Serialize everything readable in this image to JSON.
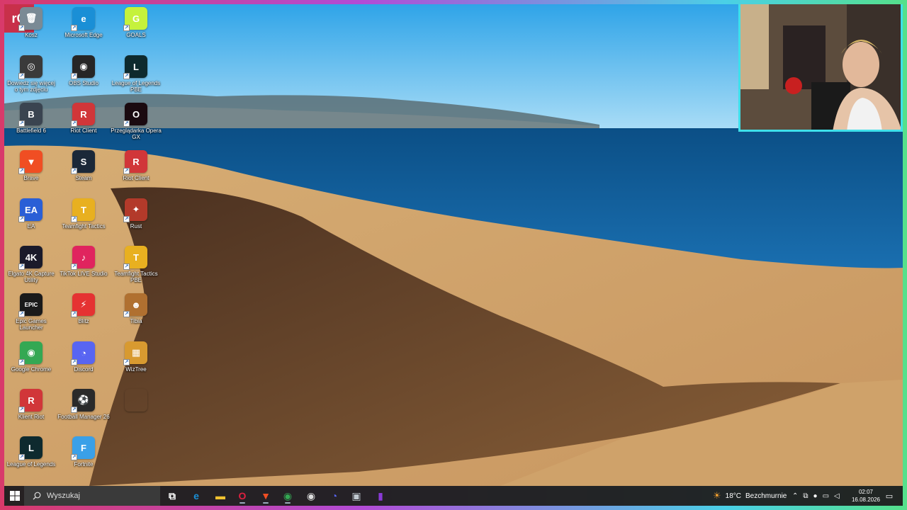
{
  "brand": {
    "logo_text": "rO",
    "logo_color": "#c8304a",
    "frame_colors": [
      "#d83a6a",
      "#b24bd6",
      "#4ad0e6",
      "#55e08a"
    ]
  },
  "desktop": {
    "icons": [
      {
        "label": "Kosz",
        "icon": "recycle-bin-icon",
        "color": "#7a8a95",
        "glyph": "🗑"
      },
      {
        "label": "Microsoft Edge",
        "icon": "edge-icon",
        "color": "#1a8fd6",
        "glyph": "e"
      },
      {
        "label": "GOALS",
        "icon": "goals-icon",
        "color": "#c5f23c",
        "glyph": "G"
      },
      {
        "label": "Dowiedz się więcej o tym zdjęciu",
        "icon": "camera-info-icon",
        "color": "#3a3a3a",
        "glyph": "◎"
      },
      {
        "label": "OBS Studio",
        "icon": "obs-icon",
        "color": "#262626",
        "glyph": "◉"
      },
      {
        "label": "League of Legends PBE",
        "icon": "league-pbe-icon",
        "color": "#0e2a2e",
        "glyph": "L"
      },
      {
        "label": "Battlefield 6",
        "icon": "battlefield-icon",
        "color": "#3a4450",
        "glyph": "B"
      },
      {
        "label": "Riot Client",
        "icon": "riot-client-icon",
        "color": "#d13639",
        "glyph": "R"
      },
      {
        "label": "Przeglądarka Opera GX",
        "icon": "opera-gx-icon",
        "color": "#1a0a10",
        "glyph": "O"
      },
      {
        "label": "Brave",
        "icon": "brave-icon",
        "color": "#f04e23",
        "glyph": "▼"
      },
      {
        "label": "Steam",
        "icon": "steam-icon",
        "color": "#1b2838",
        "glyph": "S"
      },
      {
        "label": "Riot Client",
        "icon": "riot-client-icon",
        "color": "#d13639",
        "glyph": "R"
      },
      {
        "label": "EA",
        "icon": "ea-icon",
        "color": "#2a5fd6",
        "glyph": "EA"
      },
      {
        "label": "Teamfight Tactics",
        "icon": "tft-icon",
        "color": "#e8b020",
        "glyph": "T"
      },
      {
        "label": "Rust",
        "icon": "rust-icon",
        "color": "#b33a2a",
        "glyph": "✦"
      },
      {
        "label": "Elgato 4K Capture Utility",
        "icon": "elgato-icon",
        "color": "#1a1a2a",
        "glyph": "4K"
      },
      {
        "label": "TikTok LIVE Studio",
        "icon": "tiktok-icon",
        "color": "#e0245e",
        "glyph": "♪"
      },
      {
        "label": "Teamfight Tactics PBE",
        "icon": "tft-pbe-icon",
        "color": "#e8b020",
        "glyph": "T"
      },
      {
        "label": "Epic Games Launcher",
        "icon": "epic-icon",
        "color": "#1a1a1a",
        "glyph": "EPIC"
      },
      {
        "label": "Blitz",
        "icon": "blitz-icon",
        "color": "#e53232",
        "glyph": "⚡"
      },
      {
        "label": "Tibia",
        "icon": "tibia-icon",
        "color": "#b07030",
        "glyph": "☻"
      },
      {
        "label": "Google Chrome",
        "icon": "chrome-icon",
        "color": "#34a853",
        "glyph": "◉"
      },
      {
        "label": "Discord",
        "icon": "discord-icon",
        "color": "#5865f2",
        "glyph": "◔"
      },
      {
        "label": "WizTree",
        "icon": "wiztree-icon",
        "color": "#d89a30",
        "glyph": "▦"
      },
      {
        "label": "Klient Riot",
        "icon": "riot-client-icon",
        "color": "#d13639",
        "glyph": "R"
      },
      {
        "label": "Football Manager 26",
        "icon": "football-manager-icon",
        "color": "#2a2a2a",
        "glyph": "⚽"
      },
      {
        "label": "",
        "icon": "blank-icon",
        "color": "transparent",
        "glyph": ""
      },
      {
        "label": "League of Legends",
        "icon": "league-icon",
        "color": "#0e2a2e",
        "glyph": "L"
      },
      {
        "label": "Fortnite",
        "icon": "fortnite-icon",
        "color": "#3aa0e8",
        "glyph": "F"
      }
    ]
  },
  "taskbar": {
    "search_placeholder": "Wyszukaj",
    "apps": [
      {
        "icon": "task-view-icon",
        "color": "#ffffff",
        "glyph": "⧉"
      },
      {
        "icon": "edge-icon",
        "color": "#1a8fd6",
        "glyph": "e"
      },
      {
        "icon": "file-explorer-icon",
        "color": "#f2c230",
        "glyph": "▬"
      },
      {
        "icon": "opera-gx-icon",
        "color": "#e02040",
        "glyph": "O"
      },
      {
        "icon": "brave-icon",
        "color": "#f04e23",
        "glyph": "▼"
      },
      {
        "icon": "chrome-icon",
        "color": "#34a853",
        "glyph": "◉"
      },
      {
        "icon": "obs-icon",
        "color": "#dddddd",
        "glyph": "◉"
      },
      {
        "icon": "discord-icon",
        "color": "#5865f2",
        "glyph": "◔"
      },
      {
        "icon": "app-icon",
        "color": "#c0c8d0",
        "glyph": "▣"
      },
      {
        "icon": "clipchamp-icon",
        "color": "#8a3ad6",
        "glyph": "▮"
      }
    ],
    "weather": {
      "temp": "18°C",
      "desc": "Bezchmurnie"
    },
    "time": "02:07",
    "date": "16.08.2026"
  }
}
